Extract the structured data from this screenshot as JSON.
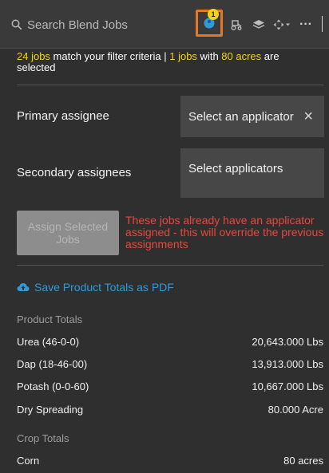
{
  "toolbar": {
    "search_placeholder": "Search Blend Jobs",
    "jobs_badge": "1",
    "more_label": "···"
  },
  "summary": {
    "jobs_count": "24 jobs",
    "match_text": " match your filter criteria | ",
    "selected_jobs": "1 jobs",
    "with_text": " with ",
    "acres": "80 acres",
    "selected_text": " are selected"
  },
  "assignees": {
    "primary_label": "Primary assignee",
    "primary_value": "Select an applicator",
    "primary_clear": "×",
    "secondary_label": "Secondary assignees",
    "secondary_placeholder": "Select applicators"
  },
  "assign_button": "Assign Selected Jobs",
  "warning": "These jobs already have an applicator assigned - this will override the previous assignments",
  "pdf_link": "Save Product Totals as PDF",
  "product_totals": {
    "title": "Product Totals",
    "rows": [
      {
        "name": "Urea (46-0-0)",
        "value": "20,643.000 Lbs"
      },
      {
        "name": "Dap (18-46-00)",
        "value": "13,913.000 Lbs"
      },
      {
        "name": "Potash (0-0-60)",
        "value": "10,667.000 Lbs"
      },
      {
        "name": "Dry Spreading",
        "value": "80.000 Acre"
      }
    ]
  },
  "crop_totals": {
    "title": "Crop Totals",
    "rows": [
      {
        "name": "Corn",
        "value": "80 acres"
      }
    ]
  },
  "colors": {
    "highlight": "#f5d21c",
    "warning": "#e8473e",
    "link": "#2e9bd8",
    "active_border": "#e07a26"
  }
}
